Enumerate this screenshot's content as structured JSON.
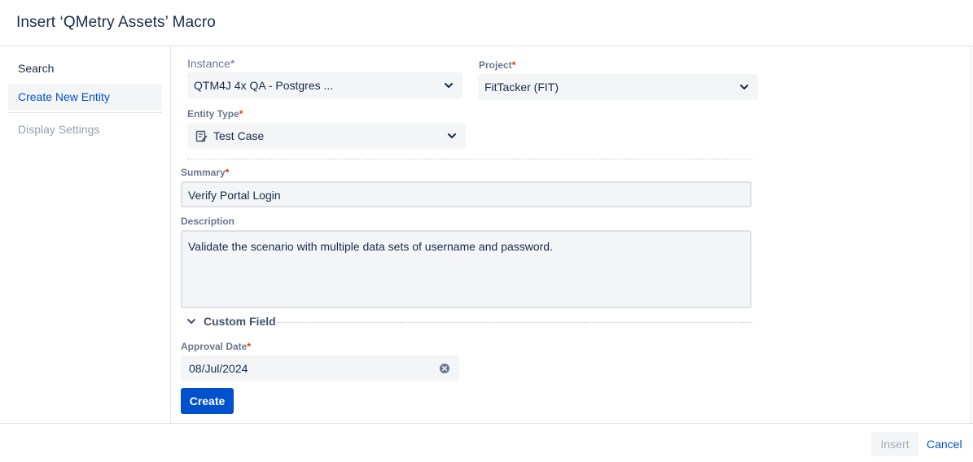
{
  "dialog": {
    "title": "Insert ‘QMetry Assets’ Macro"
  },
  "sidebar": {
    "items": [
      {
        "label": "Search"
      },
      {
        "label": "Create New Entity"
      },
      {
        "label": "Display Settings"
      }
    ]
  },
  "form": {
    "instance": {
      "label": "Instance",
      "value": "QTM4J 4x QA - Postgres ..."
    },
    "project": {
      "label": "Project",
      "value": "FitTacker (FIT)"
    },
    "entity_type": {
      "label": "Entity Type",
      "value": "Test Case",
      "icon": "test-case-icon"
    },
    "summary": {
      "label": "Summary",
      "value": "Verify Portal Login"
    },
    "description": {
      "label": "Description",
      "value": "Validate the scenario with multiple data sets of username and password."
    },
    "custom_field": {
      "label": "Custom Field"
    },
    "approval_date": {
      "label": "Approval Date",
      "value": "08/Jul/2024"
    },
    "required_marker": "*",
    "create_label": "Create"
  },
  "footer": {
    "insert_label": "Insert",
    "cancel_label": "Cancel"
  },
  "colors": {
    "primary": "#0052cc",
    "required": "#de350b",
    "field_bg": "#f4f5f7"
  }
}
